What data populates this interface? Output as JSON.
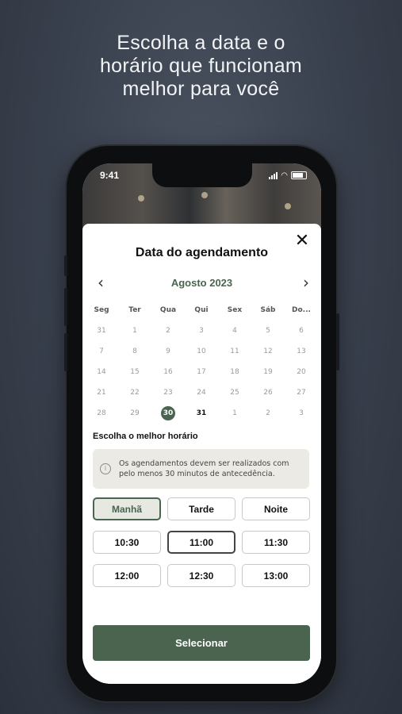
{
  "headline": [
    "Escolha a data e o",
    "horário que funcionam",
    "melhor para você"
  ],
  "status": {
    "time": "9:41"
  },
  "sheet": {
    "title": "Data do agendamento",
    "month": "Agosto 2023",
    "weekdays": [
      "Seg",
      "Ter",
      "Qua",
      "Qui",
      "Sex",
      "Sáb",
      "Do..."
    ],
    "weeks": [
      [
        "31",
        "1",
        "2",
        "3",
        "4",
        "5",
        "6"
      ],
      [
        "7",
        "8",
        "9",
        "10",
        "11",
        "12",
        "13"
      ],
      [
        "14",
        "15",
        "16",
        "17",
        "18",
        "19",
        "20"
      ],
      [
        "21",
        "22",
        "23",
        "24",
        "25",
        "26",
        "27"
      ],
      [
        "28",
        "29",
        "30",
        "31",
        "1",
        "2",
        "3"
      ]
    ],
    "selected_day": "30",
    "subtitle": "Escolha o melhor horário",
    "notice": "Os agendamentos devem ser realizados com pelo menos 30 minutos de antecedência.",
    "periods": [
      "Manhã",
      "Tarde",
      "Noite"
    ],
    "active_period": "Manhã",
    "times": [
      [
        "10:30",
        "11:00",
        "11:30"
      ],
      [
        "12:00",
        "12:30",
        "13:00"
      ]
    ],
    "selected_time": "11:00",
    "select_label": "Selecionar"
  },
  "colors": {
    "accent": "#4a6450",
    "background": "#363c48"
  }
}
